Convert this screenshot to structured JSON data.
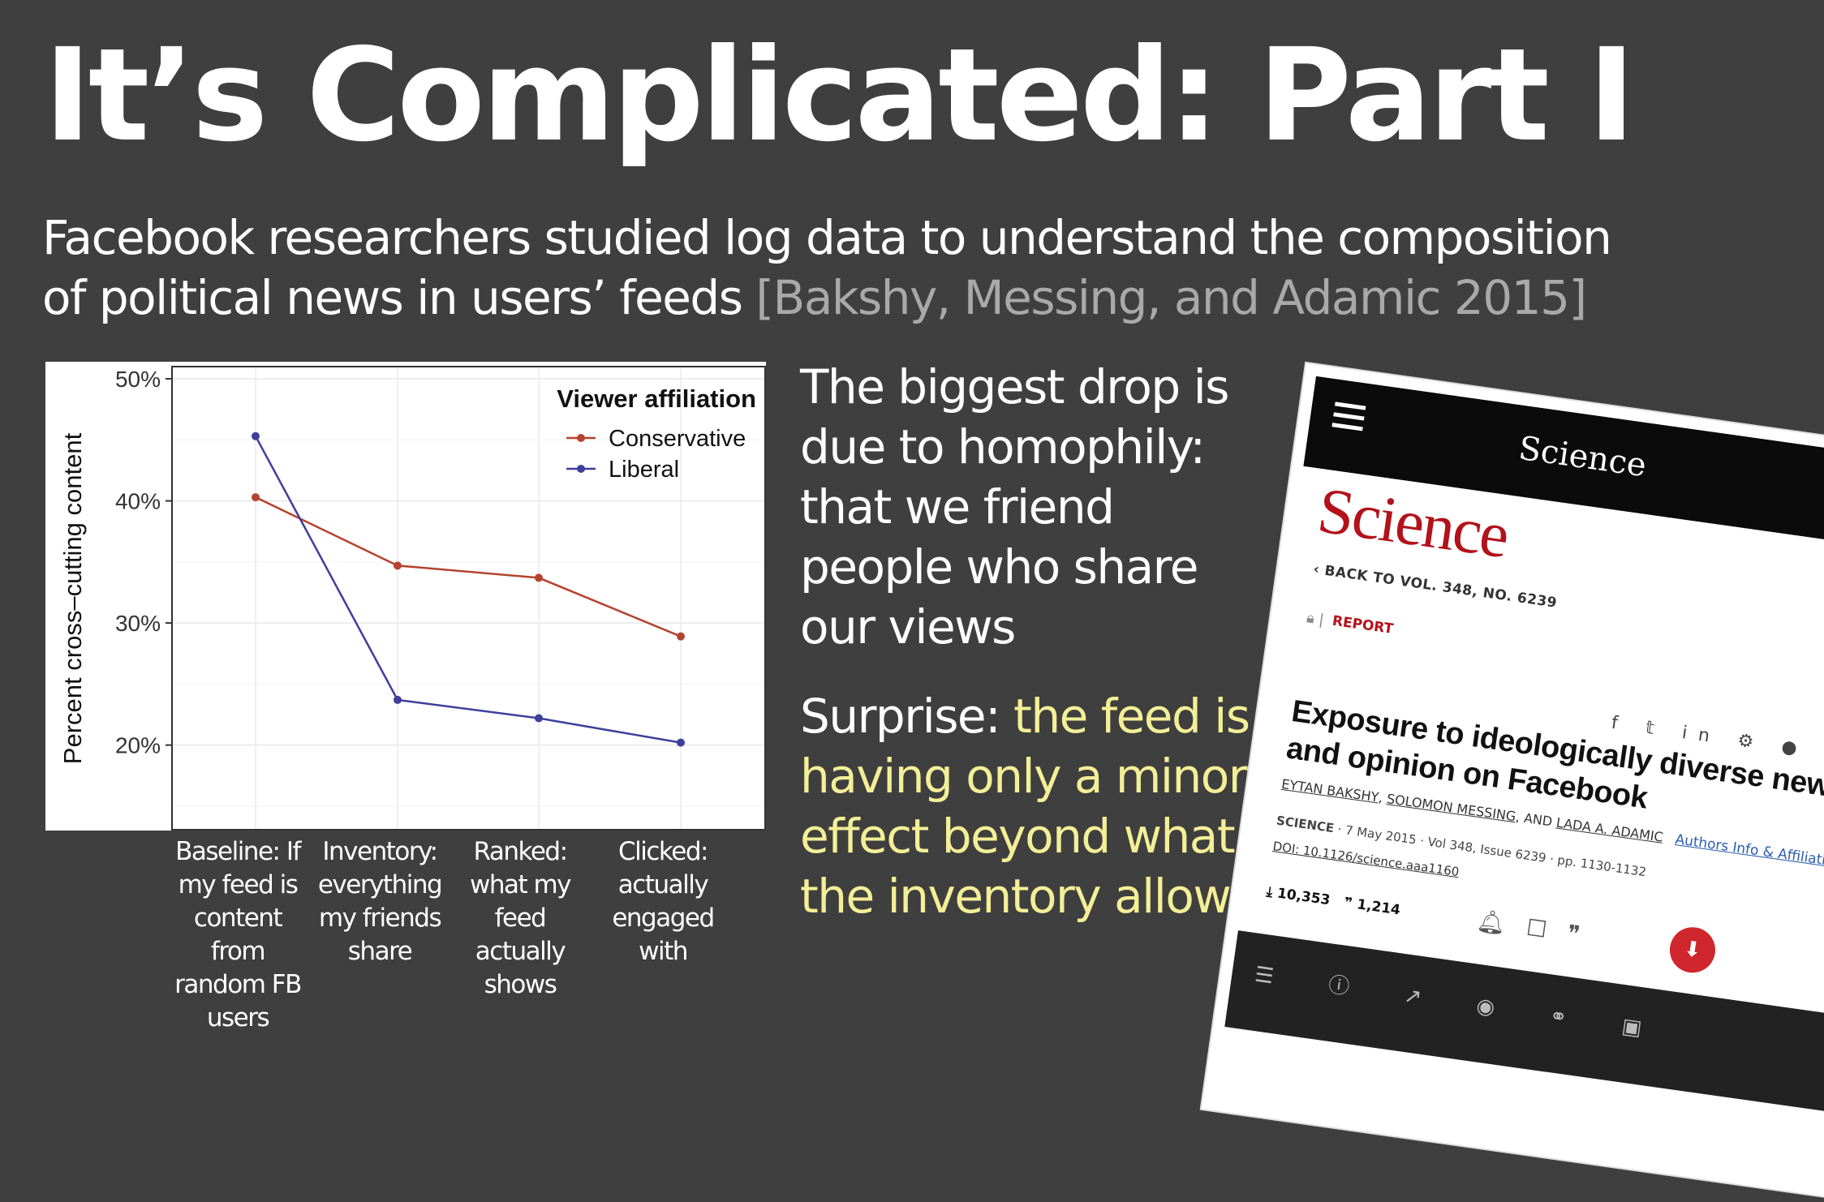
{
  "slide": {
    "title": "It’s Complicated: Part I",
    "subtitle_main": "Facebook researchers studied log data to understand the composition of political news in users’ feeds",
    "subtitle_cite": "[Bakshy, Messing, and Adamic 2015]",
    "point1": "The biggest drop is due to homophily: that we friend people who share our views",
    "point2_lead": "Surprise: ",
    "point2_highlight": "the feed is having only a minor effect beyond what the inventory allows",
    "x_categories": [
      "Baseline: If my feed is content from random FB users",
      "Inventory: everything my friends share",
      "Ranked: what my feed actually shows",
      "Clicked: actually engaged with"
    ]
  },
  "chart_data": {
    "type": "line",
    "ylabel": "Percent cross–cutting content",
    "xlabel": "",
    "ylim": [
      13,
      51
    ],
    "yticks": [
      20,
      30,
      40,
      50
    ],
    "ytick_labels": [
      "20%",
      "30%",
      "40%",
      "50%"
    ],
    "grid": true,
    "legend_title": "Viewer affiliation",
    "legend_position": "top-right",
    "series": [
      {
        "name": "Conservative",
        "color": "#b5432f",
        "values": [
          40.3,
          34.7,
          33.7,
          28.9
        ]
      },
      {
        "name": "Liberal",
        "color": "#3d3f9c",
        "values": [
          45.3,
          23.7,
          22.2,
          20.2
        ]
      }
    ]
  },
  "phone": {
    "brand": "Science",
    "logo": "Science",
    "back_link": "BACK TO VOL. 348, NO. 6239",
    "section": "REPORT",
    "headline": "Exposure to ideologically diverse news and opinion on Facebook",
    "author1": "EYTAN BAKSHY",
    "author2": "SOLOMON MESSING",
    "author3": "LADA A. ADAMIC",
    "and": ", AND ",
    "journal": "SCIENCE",
    "meta": "· 7 May 2015 · Vol 348, Issue 6239 · pp. 1130-1132",
    "authors_link": "Authors Info & Affiliations",
    "doi": "DOI: 10.1126/science.aaa1160",
    "downloads": "10,353",
    "citations": "1,214"
  }
}
